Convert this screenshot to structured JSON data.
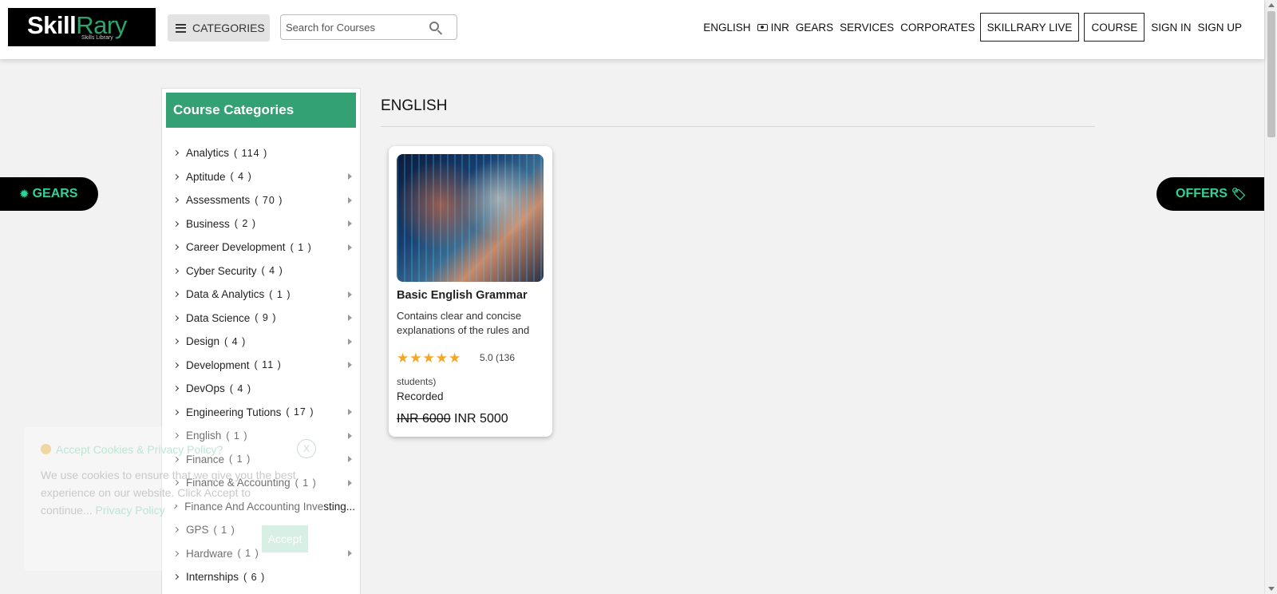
{
  "header": {
    "logo_main": "Skill",
    "logo_accent": "Rary",
    "logo_tagline": "Skills Library",
    "categories_label": "CATEGORIES",
    "search_placeholder": "Search for Courses",
    "nav": {
      "english": "ENGLISH",
      "inr": "INR",
      "gears": "GEARS",
      "services": "SERVICES",
      "corporates": "CORPORATES",
      "skillrary_live": "SKILLRARY LIVE",
      "course": "COURSE",
      "sign_in": "SIGN IN",
      "sign_up": "SIGN UP"
    }
  },
  "side_pills": {
    "gears": "GEARS",
    "offers": "OFFERS"
  },
  "sidebar": {
    "title": "Course Categories",
    "items": [
      {
        "label": "Analytics",
        "count": "( 114 )",
        "has_sub": false
      },
      {
        "label": "Aptitude",
        "count": "( 4 )",
        "has_sub": true
      },
      {
        "label": "Assessments",
        "count": "( 70 )",
        "has_sub": true
      },
      {
        "label": "Business",
        "count": "( 2 )",
        "has_sub": true
      },
      {
        "label": "Career Development",
        "count": "( 1 )",
        "has_sub": true
      },
      {
        "label": "Cyber Security",
        "count": "( 4 )",
        "has_sub": false
      },
      {
        "label": "Data & Analytics",
        "count": "( 1 )",
        "has_sub": true
      },
      {
        "label": "Data Science",
        "count": "( 9 )",
        "has_sub": true
      },
      {
        "label": "Design",
        "count": "( 4 )",
        "has_sub": true
      },
      {
        "label": "Development",
        "count": "( 11 )",
        "has_sub": true
      },
      {
        "label": "DevOps",
        "count": "( 4 )",
        "has_sub": false
      },
      {
        "label": "Engineering Tutions",
        "count": "( 17 )",
        "has_sub": true
      },
      {
        "label": "English",
        "count": "( 1 )",
        "has_sub": true
      },
      {
        "label": "Finance",
        "count": "( 1 )",
        "has_sub": true
      },
      {
        "label": "Finance & Accounting",
        "count": "( 1 )",
        "has_sub": true
      },
      {
        "label": "Finance And Accounting Investing...",
        "count": "",
        "has_sub": false
      },
      {
        "label": "GPS",
        "count": "( 1 )",
        "has_sub": false
      },
      {
        "label": "Hardware",
        "count": "( 1 )",
        "has_sub": true
      },
      {
        "label": "Internships",
        "count": "( 6 )",
        "has_sub": false
      }
    ]
  },
  "main": {
    "section_title": "ENGLISH",
    "course": {
      "title": "Basic English Grammar",
      "description": "Contains clear and concise explanations of the rules and",
      "rating": 5,
      "rating_text": "5.0 (136",
      "students_text": "students)",
      "mode": "Recorded",
      "old_price": "INR 6000",
      "new_price": "INR 5000"
    }
  },
  "cookie": {
    "title": "Accept Cookies & Privacy Policy?",
    "close": "X",
    "text": "We use cookies to ensure that we give you the best experience on our website. Click Accept to continue...",
    "link": "Privacy Policy",
    "accept": "Accept"
  }
}
